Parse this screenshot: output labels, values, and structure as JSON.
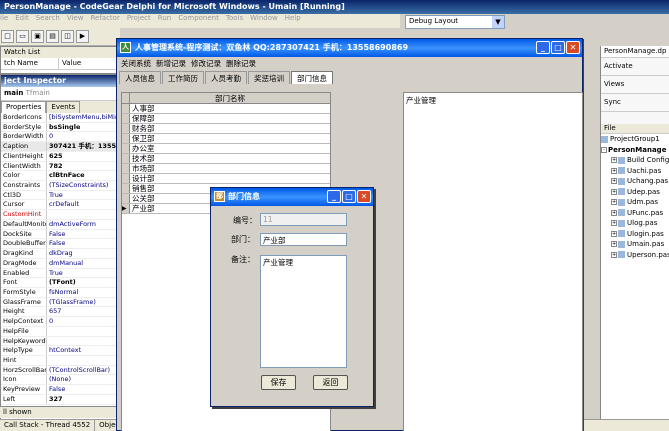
{
  "ide": {
    "title": "PersonManage - CodeGear Delphi for Microsoft Windows - Umain [Running]",
    "menu": [
      "ile",
      "Edit",
      "Search",
      "View",
      "Refactor",
      "Project",
      "Run",
      "Component",
      "Tools",
      "Window",
      "Help"
    ],
    "layout_combo": "Debug Layout",
    "watch": {
      "title": "Watch List",
      "cols": [
        "tch Name",
        "Value"
      ]
    },
    "object_inspector": {
      "title": "ject Inspector",
      "selected": "main",
      "selected_type": "Tfmain",
      "tabs": [
        "Properties",
        "Events"
      ],
      "props": [
        {
          "n": "BorderIcons",
          "v": "[biSystemMenu,biMinim"
        },
        {
          "n": "BorderStyle",
          "v": "bsSingle"
        },
        {
          "n": "BorderWidth",
          "v": "0"
        },
        {
          "n": "Caption",
          "v": "307421 手机：1355"
        },
        {
          "n": "ClientHeight",
          "v": "625"
        },
        {
          "n": "ClientWidth",
          "v": "782"
        },
        {
          "n": "Color",
          "v": "clBtnFace"
        },
        {
          "n": "Constraints",
          "v": "(TSizeConstraints)"
        },
        {
          "n": "Ctl3D",
          "v": "True"
        },
        {
          "n": "Cursor",
          "v": "crDefault"
        },
        {
          "n": "CustomHint",
          "v": ""
        },
        {
          "n": "DefaultMonitor",
          "v": "dmActiveForm"
        },
        {
          "n": "DockSite",
          "v": "False"
        },
        {
          "n": "DoubleBuffered",
          "v": "False"
        },
        {
          "n": "DragKind",
          "v": "dkDrag"
        },
        {
          "n": "DragMode",
          "v": "dmManual"
        },
        {
          "n": "Enabled",
          "v": "True"
        },
        {
          "n": "Font",
          "v": "(TFont)"
        },
        {
          "n": "FormStyle",
          "v": "fsNormal"
        },
        {
          "n": "GlassFrame",
          "v": "(TGlassFrame)"
        },
        {
          "n": "Height",
          "v": "657"
        },
        {
          "n": "HelpContext",
          "v": "0"
        },
        {
          "n": "HelpFile",
          "v": ""
        },
        {
          "n": "HelpKeyword",
          "v": ""
        },
        {
          "n": "HelpType",
          "v": "htContext"
        },
        {
          "n": "Hint",
          "v": ""
        },
        {
          "n": "HorzScrollBar",
          "v": "(TControlScrollBar)"
        },
        {
          "n": "Icon",
          "v": "(None)"
        },
        {
          "n": "KeyPreview",
          "v": "False"
        },
        {
          "n": "Left",
          "v": "327"
        }
      ],
      "footer": "ll shown"
    },
    "taskbar": [
      "Call Stack - Thread 4552",
      "Object"
    ],
    "right_panel": {
      "tab": "PersonManage.dp",
      "activate": "Activate",
      "views": "Views",
      "sync": "Sync",
      "file_header": "File",
      "group": "ProjectGroup1",
      "project": "PersonManage",
      "files": [
        "Build Configu",
        "Uachi.pas",
        "Uchang.pas",
        "Udep.pas",
        "Udm.pas",
        "UFunc.pas",
        "Ulog.pas",
        "Ulogin.pas",
        "Umain.pas",
        "Uperson.pas"
      ]
    }
  },
  "app": {
    "title": "人事管理系统-程序测试：双鱼林 QQ:287307421 手机：13558690869",
    "menu": [
      "关闭系统",
      "新增记录",
      "修改记录",
      "删除记录"
    ],
    "tabs": [
      "人员信息",
      "工作简历",
      "人员考勤",
      "奖惩培训",
      "部门信息"
    ],
    "active_tab": "部门信息",
    "grid_header": "部门名称",
    "departments": [
      "人事部",
      "保障部",
      "财务部",
      "保卫部",
      "办公室",
      "技术部",
      "市场部",
      "设计部",
      "销售部",
      "公关部",
      "产业部"
    ],
    "memo": "产业管理"
  },
  "dialog": {
    "title": "部门信息",
    "id_label": "编号：",
    "id_value": "11",
    "dept_label": "部门：",
    "dept_value": "产业部",
    "note_label": "备注：",
    "note_value": "产业管理",
    "save": "保存",
    "back": "返回"
  }
}
